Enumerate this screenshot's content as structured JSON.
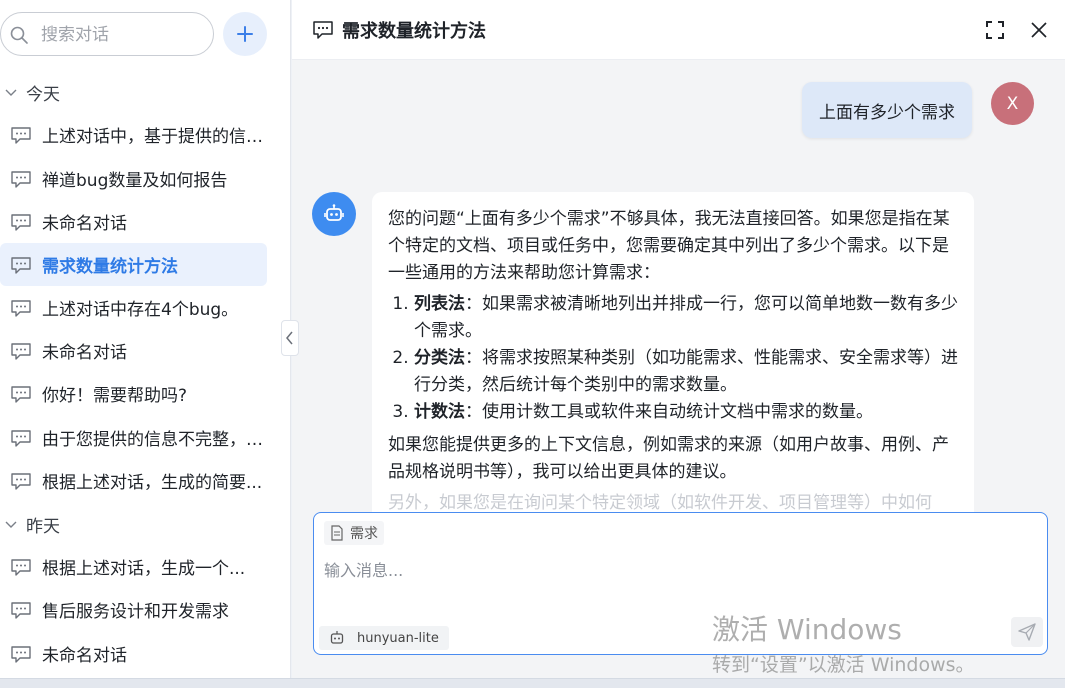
{
  "sidebar": {
    "search_placeholder": "搜索对话",
    "groups": [
      {
        "label": "今天",
        "items": [
          {
            "label": "上述对话中，基于提供的信息..."
          },
          {
            "label": "禅道bug数量及如何报告"
          },
          {
            "label": "未命名对话"
          },
          {
            "label": "需求数量统计方法"
          },
          {
            "label": "上述对话中存在4个bug。"
          },
          {
            "label": "未命名对话"
          },
          {
            "label": "你好！需要帮助吗?"
          },
          {
            "label": "由于您提供的信息不完整，无法..."
          },
          {
            "label": "根据上述对话，生成的简要..."
          }
        ]
      },
      {
        "label": "昨天",
        "items": [
          {
            "label": "根据上述对话，生成一个..."
          },
          {
            "label": "售后服务设计和开发需求"
          },
          {
            "label": "未命名对话"
          }
        ]
      }
    ]
  },
  "header": {
    "title": "需求数量统计方法"
  },
  "chat": {
    "user_message": "上面有多少个需求",
    "user_avatar_letter": "X",
    "bot": {
      "intro": "您的问题“上面有多少个需求”不够具体，我无法直接回答。如果您是指在某个特定的文档、项目或任务中，您需要确定其中列出了多少个需求。以下是一些通用的方法来帮助您计算需求：",
      "methods": [
        {
          "name": "列表法",
          "desc": "：如果需求被清晰地列出并排成一行，您可以简单地数一数有多少个需求。"
        },
        {
          "name": "分类法",
          "desc": "：将需求按照某种类别（如功能需求、性能需求、安全需求等）进行分类，然后统计每个类别中的需求数量。"
        },
        {
          "name": "计数法",
          "desc": "：使用计数工具或软件来自动统计文档中需求的数量。"
        }
      ],
      "outro": "如果您能提供更多的上下文信息，例如需求的来源（如用户故事、用例、产品规格说明书等），我可以给出更具体的建议。",
      "faded": "另外，如果您是在询问某个特定领域（如软件开发、项目管理等）中如何"
    }
  },
  "composer": {
    "tag": "需求",
    "placeholder": "输入消息...",
    "model": "hunyuan-lite"
  },
  "watermark": {
    "line1": "激活 Windows",
    "line2": "转到“设置”以激活 Windows。"
  },
  "colors": {
    "accent": "#2f7be6",
    "user_bubble": "#dde8f8",
    "avatar": "#c8707a",
    "bot_avatar": "#3e8cf0"
  }
}
